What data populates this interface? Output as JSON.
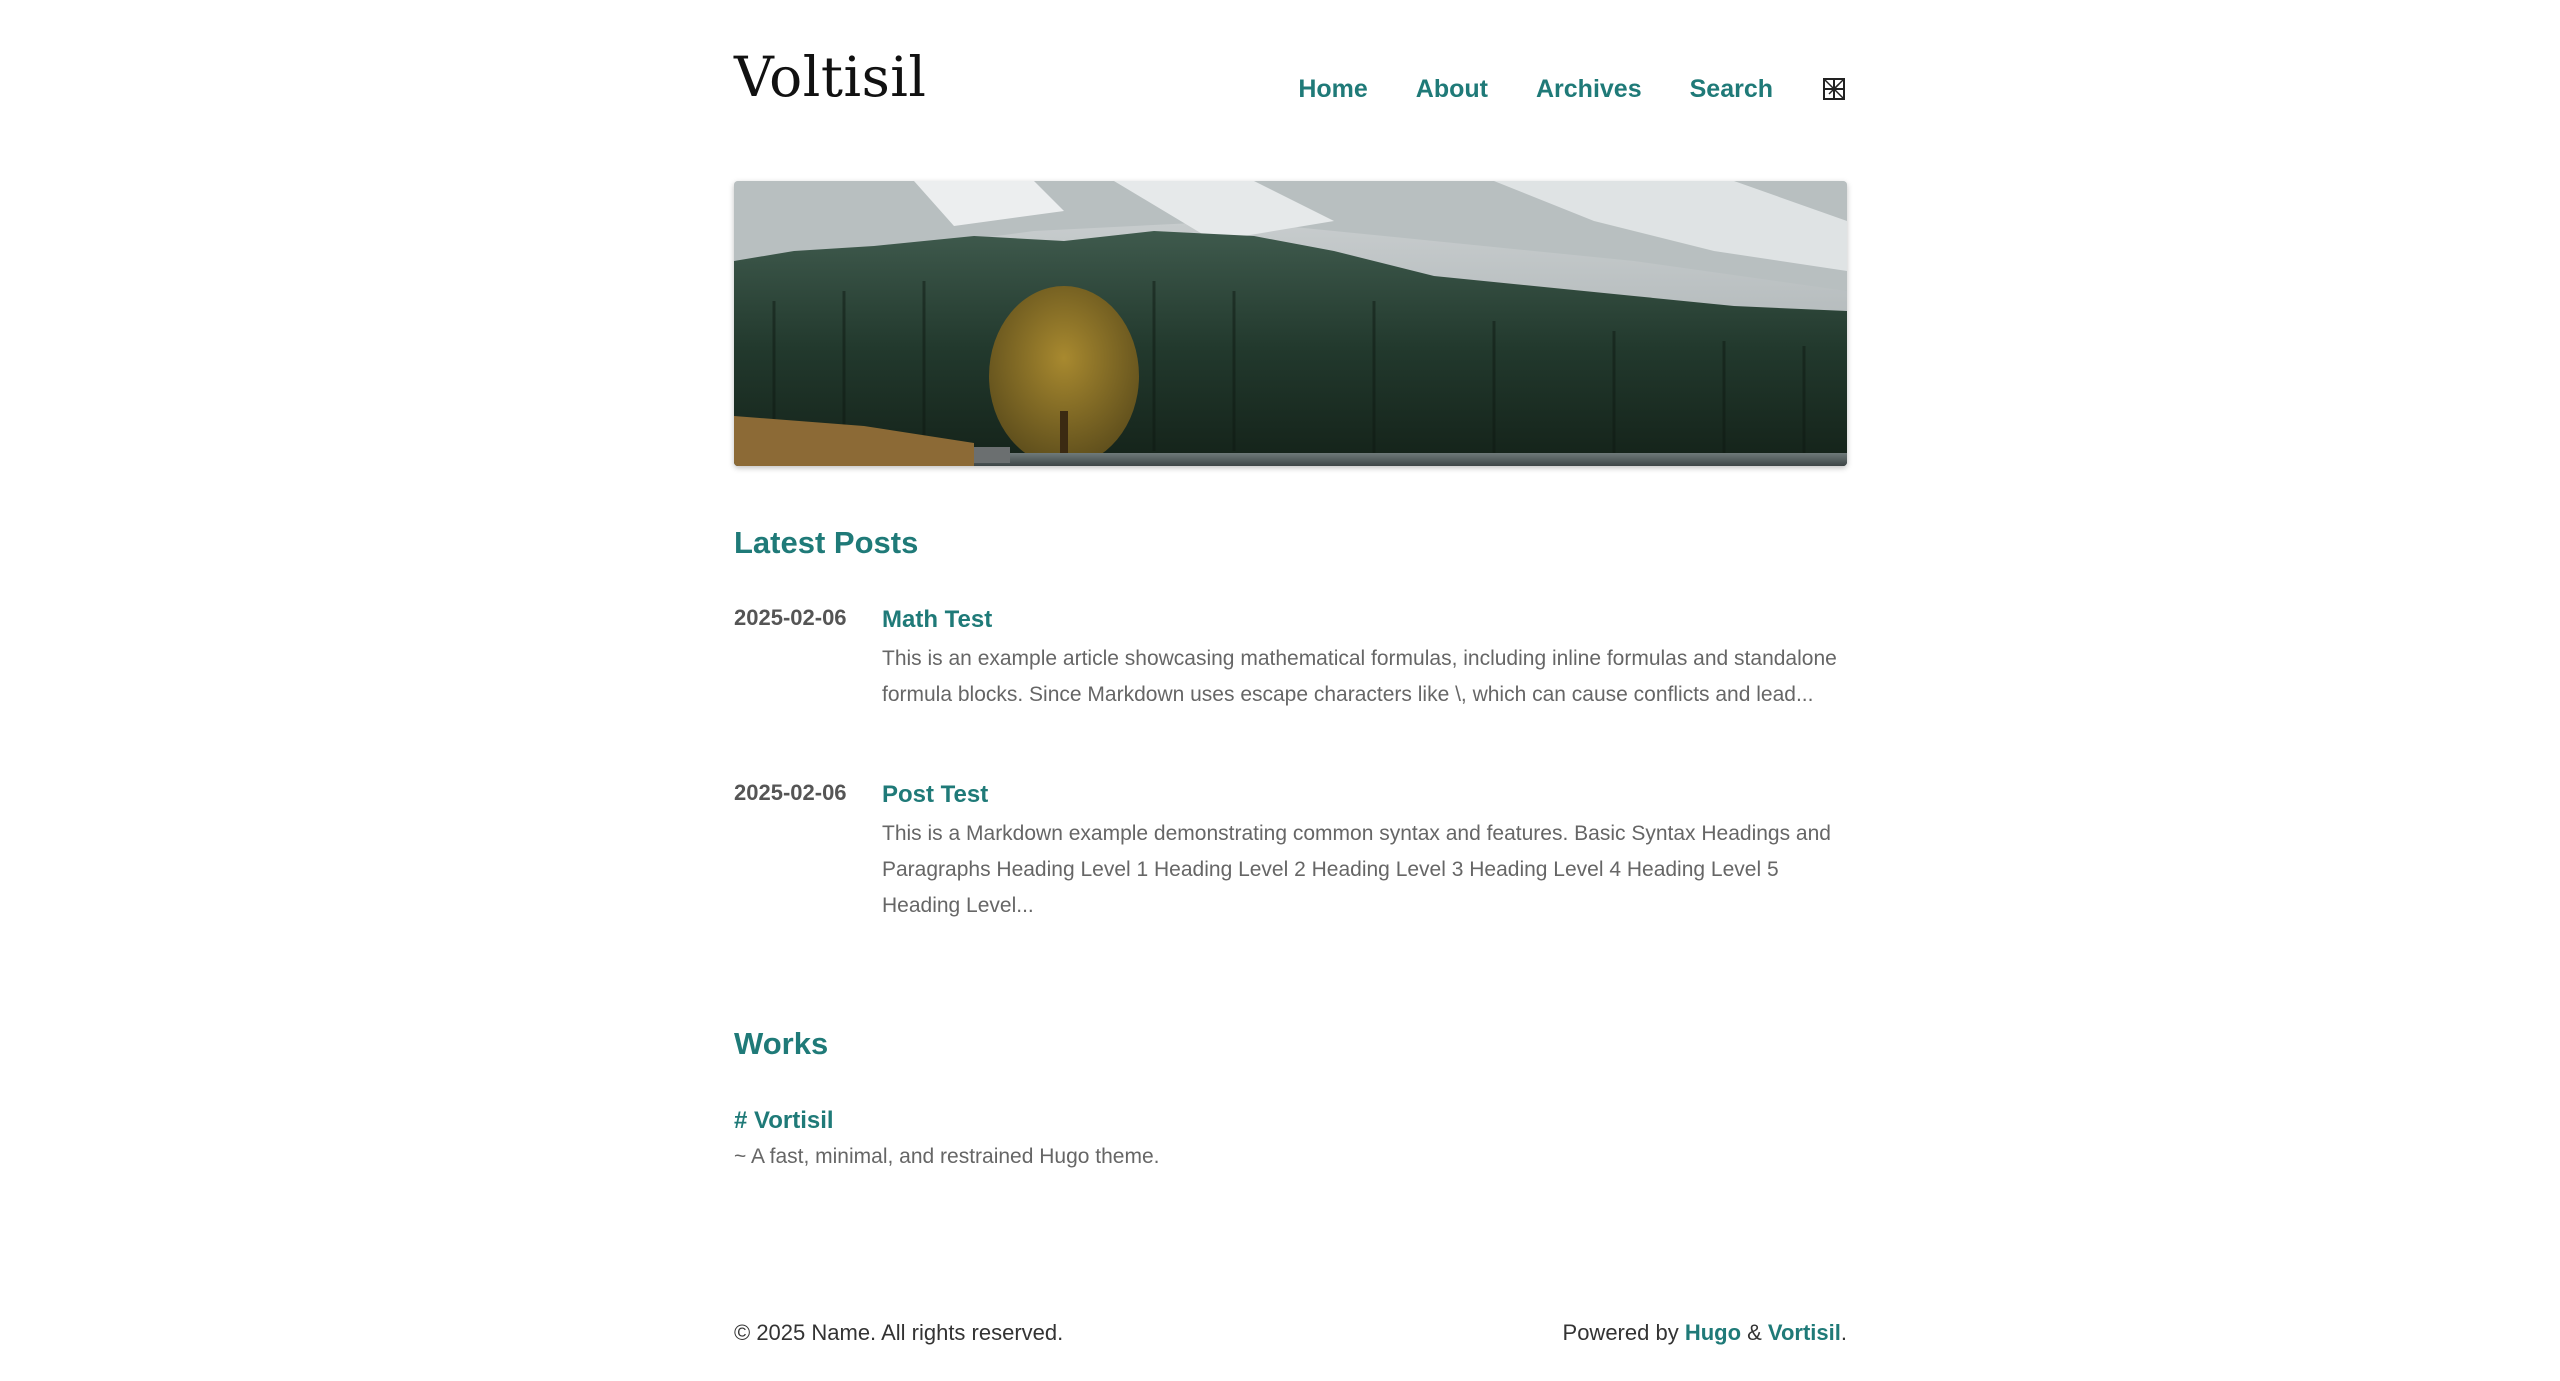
{
  "header": {
    "site_title": "Voltisil",
    "nav": [
      {
        "label": "Home"
      },
      {
        "label": "About"
      },
      {
        "label": "Archives"
      },
      {
        "label": "Search"
      }
    ],
    "theme_toggle_icon": "theme-toggle-icon"
  },
  "banner": {
    "icon": "mountain-forest-lake-image"
  },
  "latest_posts": {
    "heading": "Latest Posts",
    "posts": [
      {
        "date": "2025-02-06",
        "title": "Math Test",
        "summary": "This is an example article showcasing mathematical formulas, including inline formulas and standalone formula blocks. Since Markdown uses escape characters like \\, which can cause conflicts and lead..."
      },
      {
        "date": "2025-02-06",
        "title": "Post Test",
        "summary": "This is a Markdown example demonstrating common syntax and features. Basic Syntax Headings and Paragraphs Heading Level 1 Heading Level 2 Heading Level 3 Heading Level 4 Heading Level 5 Heading Level..."
      }
    ]
  },
  "works": {
    "heading": "Works",
    "items": [
      {
        "title": "# Vortisil",
        "description": "~ A fast, minimal, and restrained Hugo theme."
      }
    ]
  },
  "footer": {
    "copyright": "© 2025 Name. All rights reserved.",
    "powered_prefix": "Powered by ",
    "hugo_label": "Hugo",
    "amp": " & ",
    "vortisil_label": "Vortisil",
    "period": "."
  },
  "colors": {
    "accent": "#1f7a78",
    "text": "#333333",
    "muted": "#666666"
  }
}
